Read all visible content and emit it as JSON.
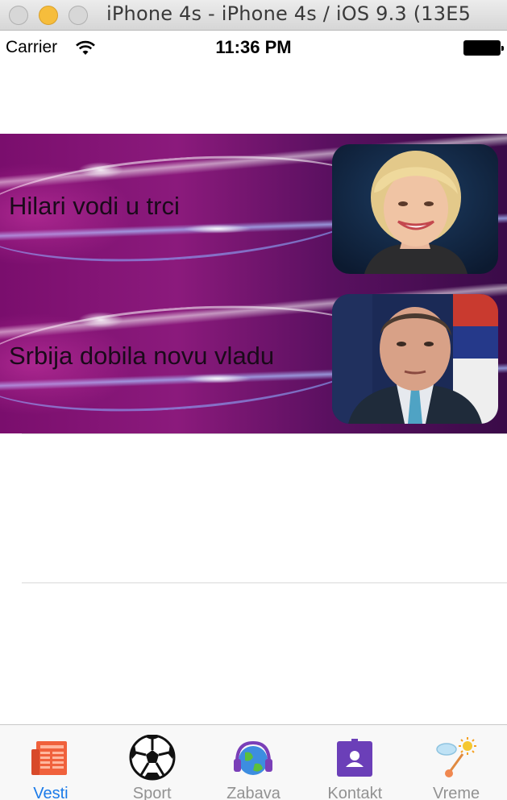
{
  "window": {
    "title": "iPhone 4s - iPhone 4s / iOS 9.3 (13E5"
  },
  "status_bar": {
    "carrier": "Carrier",
    "time": "11:36 PM"
  },
  "news": [
    {
      "title": "Hilari vodi u trci",
      "image": "photo-woman-smiling"
    },
    {
      "title": "Srbija dobila novu vladu",
      "image": "photo-man-suit-flag"
    }
  ],
  "tab_bar": {
    "active": "Vesti",
    "tabs": [
      {
        "label": "Vesti",
        "icon": "newspaper-icon"
      },
      {
        "label": "Sport",
        "icon": "soccer-ball-icon"
      },
      {
        "label": "Zabava",
        "icon": "globe-headphones-icon"
      },
      {
        "label": "Kontakt",
        "icon": "contact-card-icon"
      },
      {
        "label": "Vreme",
        "icon": "weather-icon"
      }
    ]
  },
  "colors": {
    "tab_active": "#1a7ae8",
    "tab_inactive": "#929292",
    "row_background": "#7a0e6d"
  }
}
